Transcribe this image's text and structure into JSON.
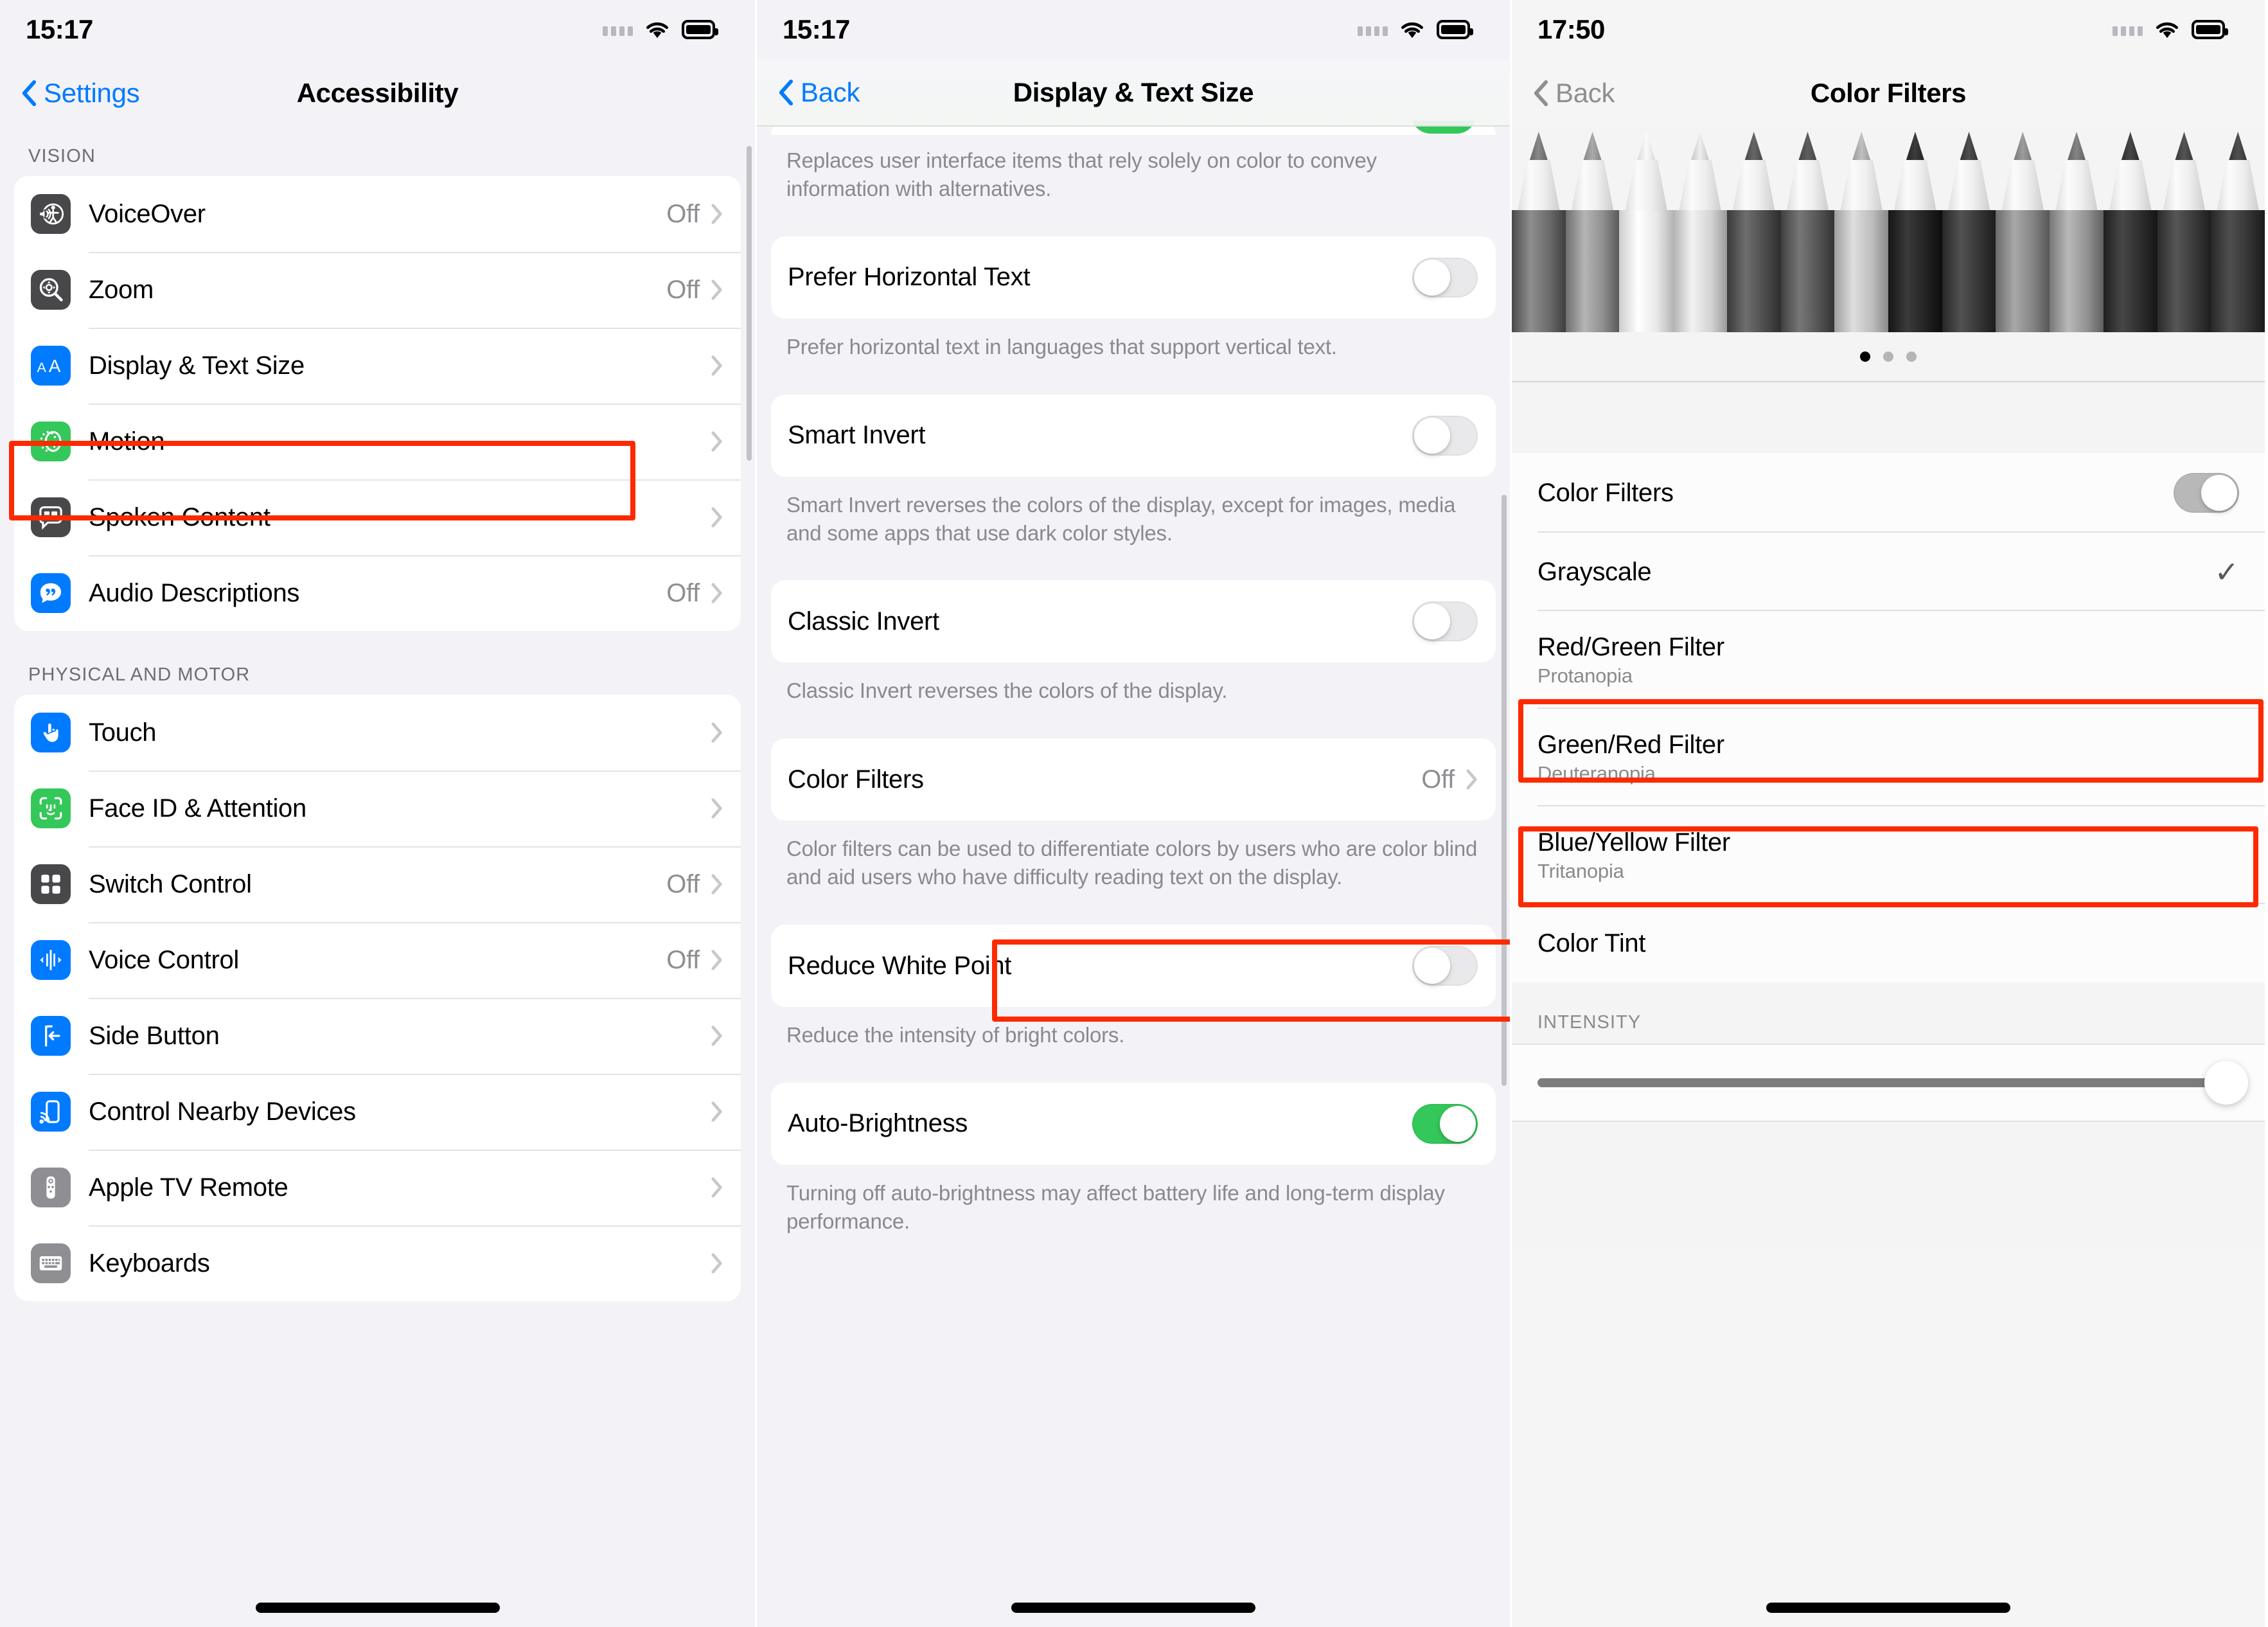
{
  "accent": {
    "blue": "#007aff",
    "green": "#34c759",
    "gray": "#8e8e93",
    "highlight": "#fd2a00"
  },
  "panel1": {
    "status": {
      "time": "15:17",
      "wifi_icon": "wifi-icon",
      "battery_icon": "battery-icon",
      "signal_icon": "signal-dots-icon"
    },
    "nav": {
      "back_label": "Settings",
      "title": "Accessibility",
      "back_icon": "chevron-left-icon"
    },
    "sections": [
      {
        "header": "VISION",
        "items": [
          {
            "label": "VoiceOver",
            "value": "Off",
            "icon": "voiceover-icon",
            "icon_color": "#48484a",
            "highlighted": false
          },
          {
            "label": "Zoom",
            "value": "Off",
            "icon": "zoom-magnifier-icon",
            "icon_color": "#48484a",
            "highlighted": false
          },
          {
            "label": "Display & Text Size",
            "value": "",
            "icon": "display-text-size-icon",
            "icon_color": "#007aff",
            "highlighted": true
          },
          {
            "label": "Motion",
            "value": "",
            "icon": "motion-icon",
            "icon_color": "#34c759",
            "highlighted": false
          },
          {
            "label": "Spoken Content",
            "value": "",
            "icon": "spoken-content-icon",
            "icon_color": "#48484a",
            "highlighted": false
          },
          {
            "label": "Audio Descriptions",
            "value": "Off",
            "icon": "audio-descriptions-icon",
            "icon_color": "#007aff",
            "highlighted": false
          }
        ]
      },
      {
        "header": "PHYSICAL AND MOTOR",
        "items": [
          {
            "label": "Touch",
            "value": "",
            "icon": "touch-hand-icon",
            "icon_color": "#007aff",
            "highlighted": false
          },
          {
            "label": "Face ID & Attention",
            "value": "",
            "icon": "face-id-icon",
            "icon_color": "#34c759",
            "highlighted": false
          },
          {
            "label": "Switch Control",
            "value": "Off",
            "icon": "switch-control-icon",
            "icon_color": "#48484a",
            "highlighted": false
          },
          {
            "label": "Voice Control",
            "value": "Off",
            "icon": "voice-control-icon",
            "icon_color": "#007aff",
            "highlighted": false
          },
          {
            "label": "Side Button",
            "value": "",
            "icon": "side-button-icon",
            "icon_color": "#007aff",
            "highlighted": false
          },
          {
            "label": "Control Nearby Devices",
            "value": "",
            "icon": "control-nearby-devices-icon",
            "icon_color": "#007aff",
            "highlighted": false
          },
          {
            "label": "Apple TV Remote",
            "value": "",
            "icon": "apple-tv-remote-icon",
            "icon_color": "#8e8e93",
            "highlighted": false
          },
          {
            "label": "Keyboards",
            "value": "",
            "icon": "keyboards-icon",
            "icon_color": "#8e8e93",
            "highlighted": false
          }
        ]
      }
    ]
  },
  "panel2": {
    "status": {
      "time": "15:17",
      "wifi_icon": "wifi-icon",
      "battery_icon": "battery-icon",
      "signal_icon": "signal-dots-icon"
    },
    "nav": {
      "back_label": "Back",
      "title": "Display & Text Size",
      "back_icon": "chevron-left-icon"
    },
    "top_caption": "Replaces user interface items that rely solely on color to convey information with alternatives.",
    "items": [
      {
        "label": "Prefer Horizontal Text",
        "type": "toggle",
        "state": "off",
        "caption": "Prefer horizontal text in languages that support vertical text.",
        "highlighted": false
      },
      {
        "label": "Smart Invert",
        "type": "toggle",
        "state": "off",
        "caption": "Smart Invert reverses the colors of the display, except for images, media and some apps that use dark color styles.",
        "highlighted": false
      },
      {
        "label": "Classic Invert",
        "type": "toggle",
        "state": "off",
        "caption": "Classic Invert reverses the colors of the display.",
        "highlighted": false
      },
      {
        "label": "Color Filters",
        "type": "link",
        "value": "Off",
        "caption": "Color filters can be used to differentiate colors by users who are color blind and aid users who have difficulty reading text on the display.",
        "highlighted": true
      },
      {
        "label": "Reduce White Point",
        "type": "toggle",
        "state": "off",
        "caption": "Reduce the intensity of bright colors.",
        "highlighted": false
      },
      {
        "label": "Auto-Brightness",
        "type": "toggle",
        "state": "on",
        "caption": "Turning off auto-brightness may affect battery life and long-term display performance.",
        "highlighted": false
      }
    ]
  },
  "panel3": {
    "status": {
      "time": "17:50",
      "wifi_icon": "wifi-icon",
      "battery_icon": "battery-icon",
      "signal_icon": "signal-dots-icon"
    },
    "nav": {
      "back_label": "Back",
      "title": "Color Filters",
      "back_icon": "chevron-left-icon"
    },
    "preview": {
      "name": "pencils-grayscale-preview",
      "page_dots": 3,
      "active_dot": 1
    },
    "toggle_row": {
      "label": "Color Filters",
      "state": "on",
      "highlighted": true
    },
    "filters": [
      {
        "label": "Grayscale",
        "sub": "",
        "selected": true,
        "highlighted": true,
        "check_icon": "checkmark-icon"
      },
      {
        "label": "Red/Green Filter",
        "sub": "Protanopia",
        "selected": false,
        "highlighted": false
      },
      {
        "label": "Green/Red Filter",
        "sub": "Deuteranopia",
        "selected": false,
        "highlighted": false
      },
      {
        "label": "Blue/Yellow Filter",
        "sub": "Tritanopia",
        "selected": false,
        "highlighted": false
      },
      {
        "label": "Color Tint",
        "sub": "",
        "selected": false,
        "highlighted": false
      }
    ],
    "intensity": {
      "header": "INTENSITY",
      "value": 100
    }
  }
}
